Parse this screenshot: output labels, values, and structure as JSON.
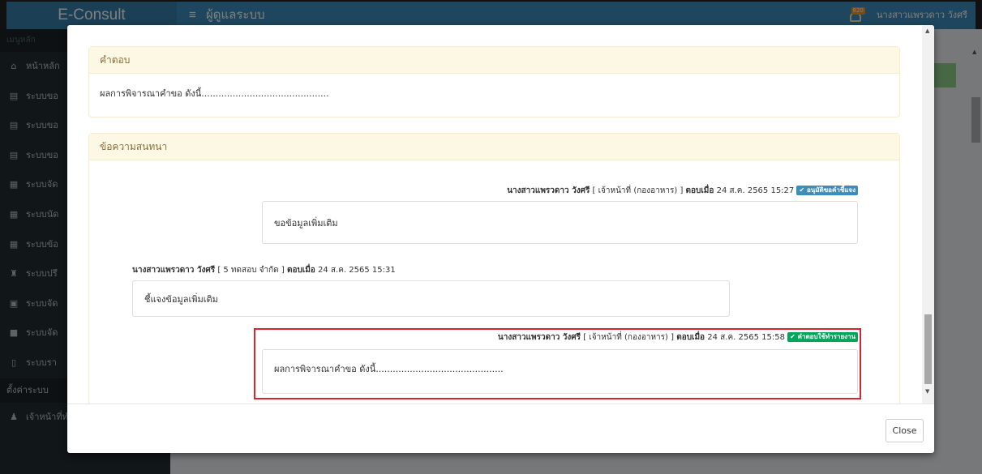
{
  "app": {
    "brand": "E-Consult",
    "menu_label": "ผู้ดูแลระบบ",
    "user_name": "นางสาวแพรวดาว วังศรี",
    "notification_count": "820"
  },
  "sidebar": {
    "header": "เมนูหลัก",
    "items": [
      {
        "icon": "home-icon",
        "label": "หน้าหลัก"
      },
      {
        "icon": "book-icon",
        "label": "ระบบขอ"
      },
      {
        "icon": "book-icon",
        "label": "ระบบขอ"
      },
      {
        "icon": "book-icon",
        "label": "ระบบขอ"
      },
      {
        "icon": "calendar-icon",
        "label": "ระบบจัด"
      },
      {
        "icon": "calendar-icon",
        "label": "ระบบนัด"
      },
      {
        "icon": "calendar-icon",
        "label": "ระบบข้อ"
      },
      {
        "icon": "graduation-cap-icon",
        "label": "ระบบปรึ"
      },
      {
        "icon": "id-card-icon",
        "label": "ระบบจัด"
      },
      {
        "icon": "video-icon",
        "label": "ระบบจัด"
      },
      {
        "icon": "file-icon",
        "label": "ระบบรา"
      }
    ],
    "settings_header": "ตั้งค่าระบบ",
    "delegate_item": {
      "icon": "user-icon",
      "label": "เจ้าหน้าที่ทำแทน"
    }
  },
  "modal": {
    "answer_panel": {
      "title": "คำตอบ",
      "body": "ผลการพิจารณาคำขอ ดังนี้............................................."
    },
    "conversation_panel": {
      "title": "ข้อความสนทนา",
      "messages": [
        {
          "name": "นางสาวแพรวดาว วังศรี",
          "role": "[ เจ้าหน้าที่ (กองอาหาร) ]",
          "replied_label": "ตอบเมื่อ",
          "datetime": "24 ส.ค. 2565 15:27",
          "badge": "✔ อนุมัติขอคำชี้แจง",
          "text": "ขอข้อมูลเพิ่มเติม"
        },
        {
          "name": "นางสาวแพรวดาว วังศรี",
          "role": "[ 5 ทดสอบ จำกัด ]",
          "replied_label": "ตอบเมื่อ",
          "datetime": "24 ส.ค. 2565 15:31",
          "badge": "",
          "text": "ชี้แจงข้อมูลเพิ่มเติม"
        },
        {
          "name": "นางสาวแพรวดาว วังศรี",
          "role": "[ เจ้าหน้าที่ (กองอาหาร) ]",
          "replied_label": "ตอบเมื่อ",
          "datetime": "24 ส.ค. 2565 15:58",
          "badge": "✔ คำตอบใช้ทำรายงาน",
          "text": "ผลการพิจารณาคำขอ ดังนี้............................................."
        }
      ]
    },
    "close_label": "Close"
  },
  "colors": {
    "header_blue": "#3c8dbc",
    "sidebar_dark": "#222d32",
    "panel_warning_bg": "#fcf8e3",
    "badge_blue": "#3c8dbc",
    "badge_green": "#00a65a",
    "highlight_red": "#d9232e"
  }
}
